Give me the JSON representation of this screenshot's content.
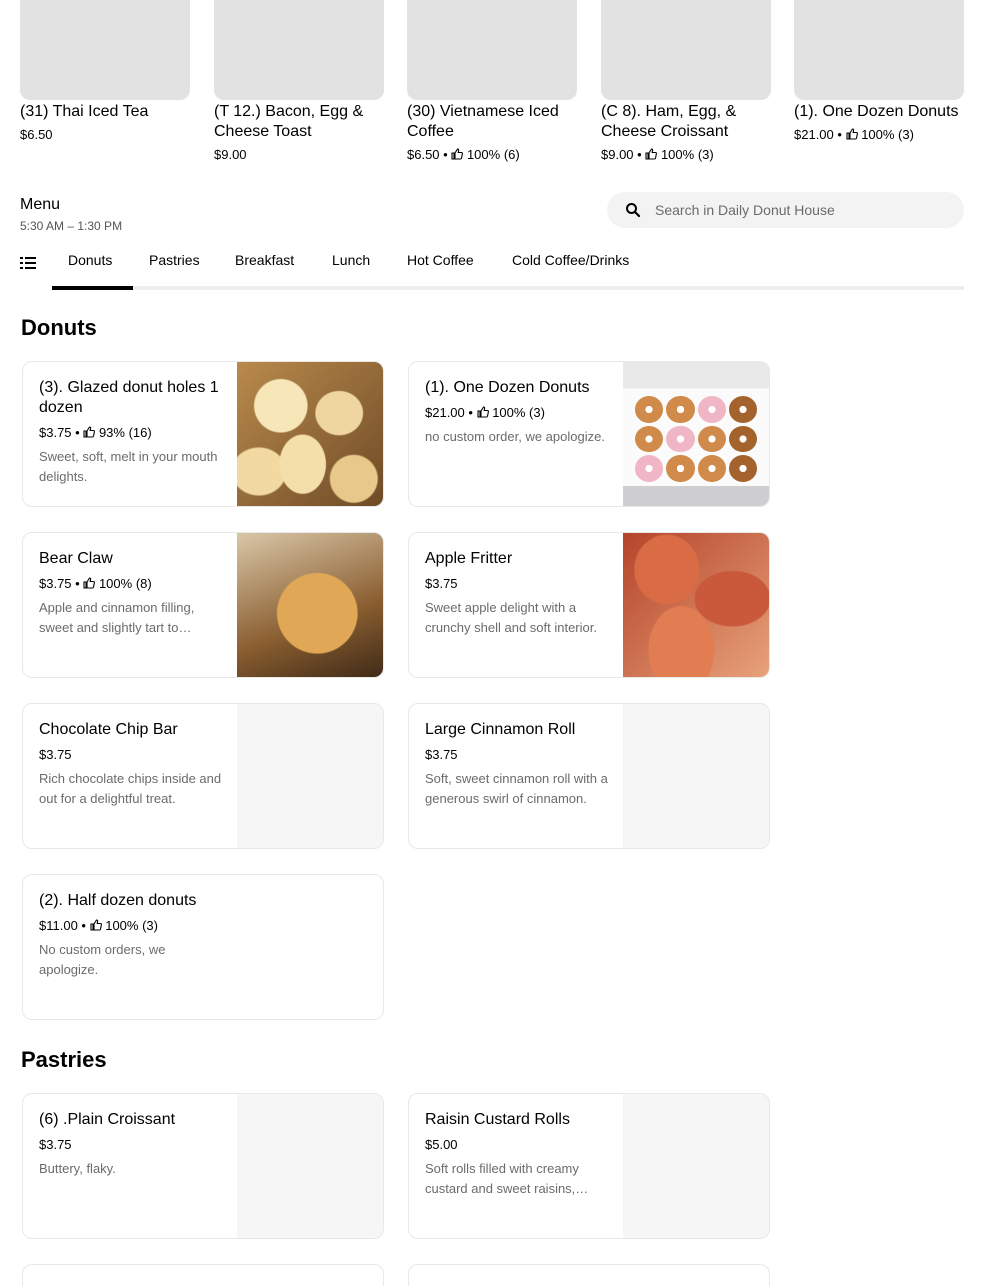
{
  "featured": [
    {
      "title": "(31) Thai Iced Tea",
      "price": "$6.50",
      "rating": ""
    },
    {
      "title": "(T 12.) Bacon, Egg & Cheese Toast",
      "price": "$9.00",
      "rating": ""
    },
    {
      "title": "(30) Vietnamese Iced Coffee",
      "price": "$6.50 •",
      "rating": "100% (6)"
    },
    {
      "title": "(C 8). Ham, Egg, & Cheese Croissant",
      "price": "$9.00 •",
      "rating": "100% (3)"
    },
    {
      "title": "(1). One Dozen Donuts",
      "price": "$21.00 •",
      "rating": "100% (3)"
    }
  ],
  "menu": {
    "title": "Menu",
    "hours": "5:30 AM – 1:30 PM"
  },
  "search": {
    "placeholder": "Search in Daily Donut House"
  },
  "tabs": [
    "Donuts",
    "Pastries",
    "Breakfast",
    "Lunch",
    "Hot Coffee",
    "Cold Coffee/Drinks"
  ],
  "sections": {
    "donuts": {
      "title": "Donuts",
      "items": [
        {
          "title": "(3). Glazed donut holes 1 dozen",
          "price": "$3.75 •",
          "rating": "93% (16)",
          "desc": "Sweet, soft, melt in your mouth delights."
        },
        {
          "title": "(1). One Dozen Donuts",
          "price": "$21.00 •",
          "rating": "100% (3)",
          "desc": "no custom order, we apologize."
        },
        {
          "title": "Bear Claw",
          "price": "$3.75 •",
          "rating": "100% (8)",
          "desc": "Apple and cinnamon filling, sweet and slightly tart to balance the rich pastry."
        },
        {
          "title": "Apple Fritter",
          "price": "$3.75",
          "rating": "",
          "desc": "Sweet apple delight with a crunchy shell and soft interior."
        },
        {
          "title": "Chocolate Chip Bar",
          "price": "$3.75",
          "rating": "",
          "desc": "Rich chocolate chips inside and out for a delightful treat."
        },
        {
          "title": "Large Cinnamon Roll",
          "price": "$3.75",
          "rating": "",
          "desc": "Soft, sweet cinnamon roll with a generous swirl of cinnamon."
        },
        {
          "title": "(2). Half dozen donuts",
          "price": "$11.00 •",
          "rating": "100% (3)",
          "desc": "No custom orders, we apologize."
        }
      ]
    },
    "pastries": {
      "title": "Pastries",
      "items": [
        {
          "title": "(6) .Plain Croissant",
          "price": "$3.75",
          "rating": "",
          "desc": "Buttery, flaky."
        },
        {
          "title": "Raisin Custard Rolls",
          "price": "$5.00",
          "rating": "",
          "desc": "Soft rolls filled with creamy custard and sweet raisins, baked golden."
        }
      ]
    }
  }
}
